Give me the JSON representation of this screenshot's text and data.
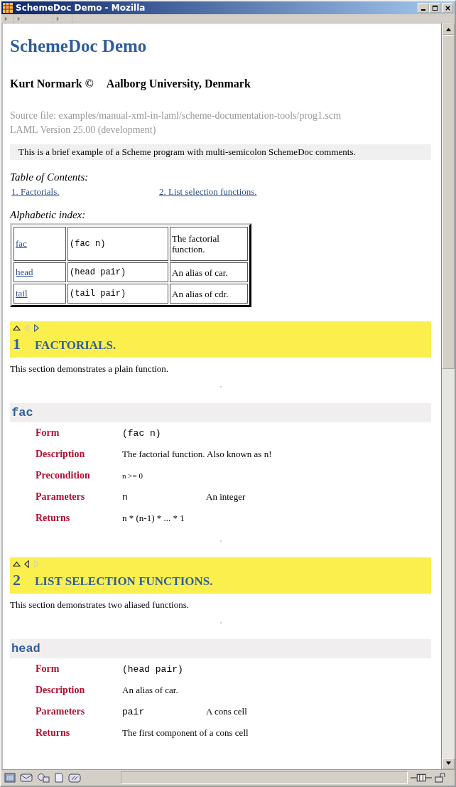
{
  "window": {
    "title": "SchemeDoc Demo - Mozilla"
  },
  "page": {
    "title": "SchemeDoc Demo",
    "author": "Kurt Normark ©",
    "affiliation": "Aalborg University, Denmark",
    "source_file": "Source file: examples/manual-xml-in-laml/scheme-documentation-tools/prog1.scm",
    "version": "LAML Version 25.00 (development)",
    "intro": "This is a brief example of a Scheme program with multi-semicolon SchemeDoc comments.",
    "toc_label": "Table of Contents:",
    "toc": [
      "1. Factorials.",
      "2. List selection functions."
    ],
    "index_label": "Alphabetic index:",
    "index": [
      {
        "name": "fac",
        "form": "(fac n)",
        "description": "The factorial function."
      },
      {
        "name": "head",
        "form": "(head pair)",
        "description": "An alias of car."
      },
      {
        "name": "tail",
        "form": "(tail pair)",
        "description": "An alias of cdr."
      }
    ]
  },
  "sections": [
    {
      "number": "1",
      "title": "FACTORIALS.",
      "nav": {
        "up": true,
        "prev": false,
        "next": true
      },
      "text": "This section demonstrates a plain function.",
      "entries": [
        {
          "name": "fac",
          "fields": [
            {
              "kind": "code",
              "label": "Form",
              "value": "(fac n)"
            },
            {
              "kind": "text",
              "label": "Description",
              "value": "The factorial function. Also known as n!"
            },
            {
              "kind": "small",
              "label": "Precondition",
              "value": "n >= 0"
            },
            {
              "kind": "param",
              "label": "Parameters",
              "value": "n",
              "note": "An integer"
            },
            {
              "kind": "text",
              "label": "Returns",
              "value": "n * (n-1) * ... * 1"
            }
          ]
        }
      ]
    },
    {
      "number": "2",
      "title": "LIST SELECTION FUNCTIONS.",
      "nav": {
        "up": true,
        "prev": true,
        "next": false
      },
      "text": "This section demonstrates two aliased functions.",
      "entries": [
        {
          "name": "head",
          "fields": [
            {
              "kind": "code",
              "label": "Form",
              "value": "(head pair)"
            },
            {
              "kind": "text",
              "label": "Description",
              "value": "An alias of car."
            },
            {
              "kind": "param",
              "label": "Parameters",
              "value": "pair",
              "note": "A cons cell"
            },
            {
              "kind": "text",
              "label": "Returns",
              "value": "The first component of a cons cell"
            }
          ]
        }
      ]
    }
  ]
}
